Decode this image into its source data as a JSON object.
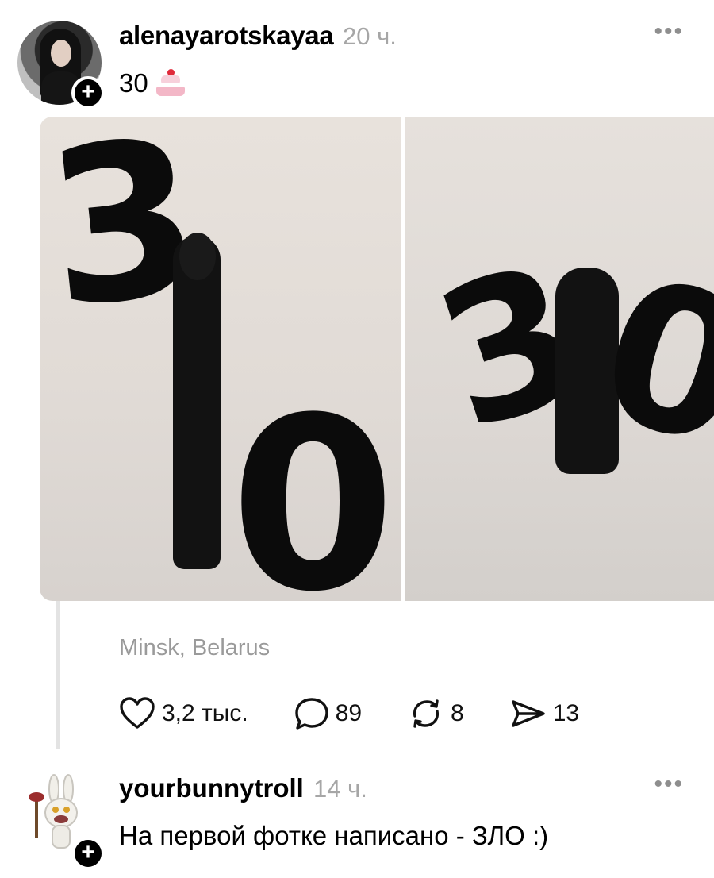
{
  "post": {
    "username": "alenayarotskayaa",
    "time": "20 ч.",
    "text": "30",
    "emoji_icon": "birthday-cake-icon",
    "more_label": "•••",
    "location": "Minsk, Belarus",
    "follow_badge": "+",
    "photos": [
      {
        "balloon_digits": [
          "3",
          "0"
        ]
      },
      {
        "balloon_digits": [
          "3",
          "0"
        ]
      }
    ],
    "actions": {
      "likes": "3,2 тыс.",
      "comments": "89",
      "reposts": "8",
      "shares": "13"
    }
  },
  "reply": {
    "username": "yourbunnytroll",
    "time": "14 ч.",
    "text": "На первой фотке написано - ЗЛО :)",
    "more_label": "•••",
    "follow_badge": "+"
  },
  "colors": {
    "text": "#000000",
    "muted": "#a6a6a6",
    "thread_line": "#e3e3e3"
  }
}
